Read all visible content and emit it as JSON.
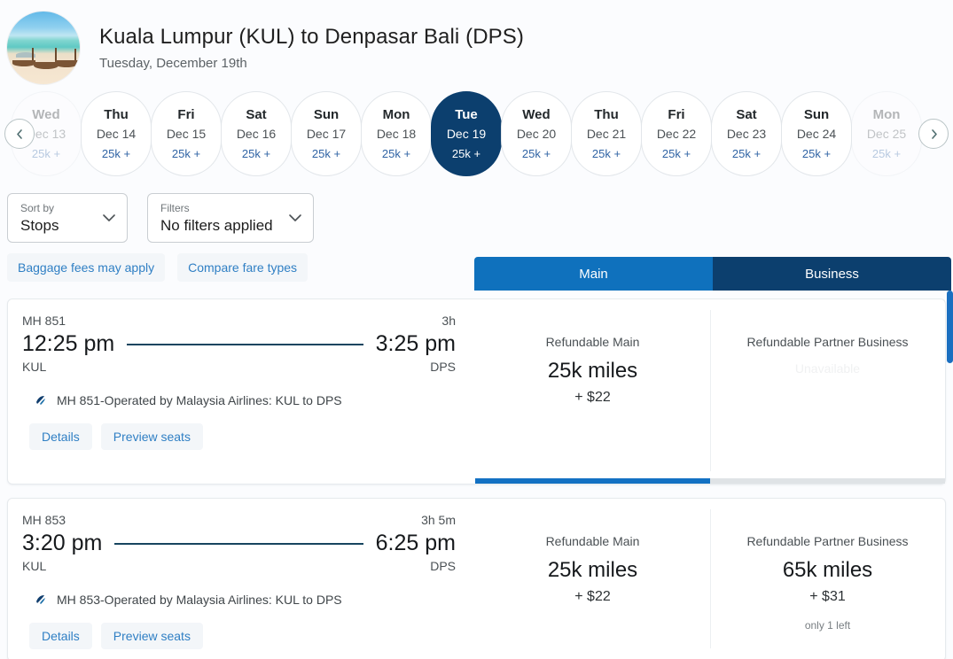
{
  "header": {
    "title": "Kuala Lumpur (KUL) to Denpasar Bali (DPS)",
    "subtitle": "Tuesday, December 19th",
    "avatar_icon": "beach-photo-avatar"
  },
  "carousel": {
    "prev_icon": "chevron-left-icon",
    "next_icon": "chevron-right-icon",
    "days": [
      {
        "dow": "Wed",
        "date": "Dec 13",
        "miles": "25k +",
        "state": "faded"
      },
      {
        "dow": "Thu",
        "date": "Dec 14",
        "miles": "25k +",
        "state": "normal"
      },
      {
        "dow": "Fri",
        "date": "Dec 15",
        "miles": "25k +",
        "state": "normal"
      },
      {
        "dow": "Sat",
        "date": "Dec 16",
        "miles": "25k +",
        "state": "normal"
      },
      {
        "dow": "Sun",
        "date": "Dec 17",
        "miles": "25k +",
        "state": "normal"
      },
      {
        "dow": "Mon",
        "date": "Dec 18",
        "miles": "25k +",
        "state": "normal"
      },
      {
        "dow": "Tue",
        "date": "Dec 19",
        "miles": "25k +",
        "state": "selected"
      },
      {
        "dow": "Wed",
        "date": "Dec 20",
        "miles": "25k +",
        "state": "normal"
      },
      {
        "dow": "Thu",
        "date": "Dec 21",
        "miles": "25k +",
        "state": "normal"
      },
      {
        "dow": "Fri",
        "date": "Dec 22",
        "miles": "25k +",
        "state": "normal"
      },
      {
        "dow": "Sat",
        "date": "Dec 23",
        "miles": "25k +",
        "state": "normal"
      },
      {
        "dow": "Sun",
        "date": "Dec 24",
        "miles": "25k +",
        "state": "normal"
      },
      {
        "dow": "Mon",
        "date": "Dec 25",
        "miles": "25k +",
        "state": "faded"
      }
    ]
  },
  "controls": {
    "sort": {
      "label": "Sort by",
      "value": "Stops",
      "chevron_icon": "chevron-down-icon"
    },
    "filters": {
      "label": "Filters",
      "value": "No filters applied",
      "chevron_icon": "chevron-down-icon"
    },
    "links": [
      {
        "label": "Baggage fees may apply"
      },
      {
        "label": "Compare fare types"
      }
    ]
  },
  "fare_tabs": [
    {
      "label": "Main",
      "color": "#0f71bd",
      "selected": true
    },
    {
      "label": "Business",
      "color": "#0c3f6e",
      "selected": false
    }
  ],
  "flights": [
    {
      "flight_no": "MH 851",
      "duration": "3h",
      "depart_time": "12:25 pm",
      "arrive_time": "3:25 pm",
      "origin": "KUL",
      "destination": "DPS",
      "operated_by": "MH 851-Operated by Malaysia Airlines: KUL to DPS",
      "airline_icon": "malaysia-airlines-logo-icon",
      "actions": [
        {
          "label": "Details"
        },
        {
          "label": "Preview seats"
        }
      ],
      "fares": [
        {
          "name": "Refundable Main",
          "miles": "25k miles",
          "cash": "+ $22",
          "unavailable": "",
          "note": "",
          "available": true
        },
        {
          "name": "Refundable Partner Business",
          "miles": "",
          "cash": "",
          "unavailable": "Unavailable",
          "note": "",
          "available": false
        }
      ],
      "show_underline": true
    },
    {
      "flight_no": "MH 853",
      "duration": "3h 5m",
      "depart_time": "3:20 pm",
      "arrive_time": "6:25 pm",
      "origin": "KUL",
      "destination": "DPS",
      "operated_by": "MH 853-Operated by Malaysia Airlines: KUL to DPS",
      "airline_icon": "malaysia-airlines-logo-icon",
      "actions": [
        {
          "label": "Details"
        },
        {
          "label": "Preview seats"
        }
      ],
      "fares": [
        {
          "name": "Refundable Main",
          "miles": "25k miles",
          "cash": "+ $22",
          "unavailable": "",
          "note": "",
          "available": true
        },
        {
          "name": "Refundable Partner Business",
          "miles": "65k miles",
          "cash": "+ $31",
          "unavailable": "",
          "note": "only 1 left",
          "available": true
        }
      ],
      "show_underline": false
    }
  ],
  "colors": {
    "accent_blue": "#1371c3",
    "tab_main": "#0f71bd",
    "tab_business": "#0c3f6e",
    "selected_pill": "#0c3f6e",
    "link_blue": "#2f7fc4",
    "path_line": "#17455f"
  }
}
